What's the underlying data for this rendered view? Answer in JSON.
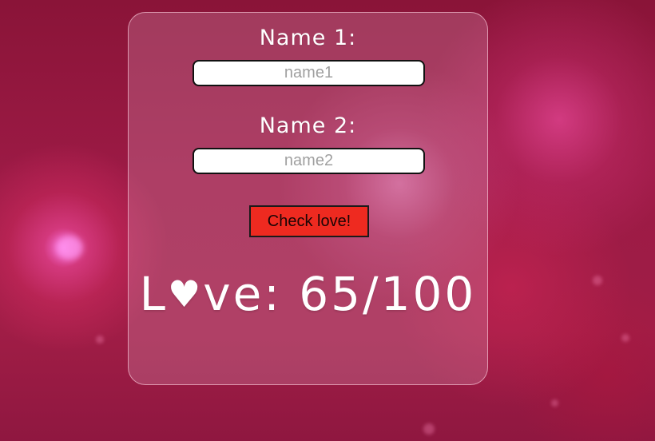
{
  "form": {
    "name1_label": "Name 1:",
    "name1_placeholder": "name1",
    "name1_value": "",
    "name2_label": "Name 2:",
    "name2_placeholder": "name2",
    "name2_value": "",
    "check_button_label": "Check love!"
  },
  "result": {
    "prefix_l": "L",
    "heart_glyph": "♥",
    "prefix_rest": "ve:",
    "score": "65/100"
  },
  "colors": {
    "background": "#9c1a45",
    "button": "#ee2a20",
    "text": "#ffffff"
  }
}
